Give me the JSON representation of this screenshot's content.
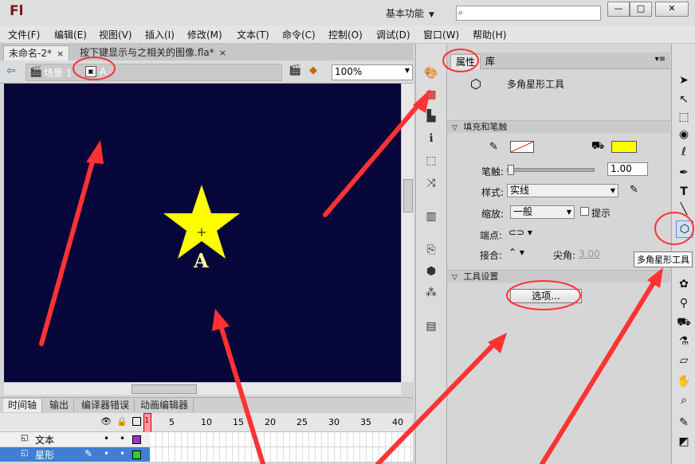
{
  "app": {
    "logo": "Fl",
    "workspace": "基本功能"
  },
  "window_buttons": {
    "minimize": "—",
    "maximize": "□",
    "close": "✕"
  },
  "menu": [
    "文件(F)",
    "编辑(E)",
    "视图(V)",
    "插入(I)",
    "修改(M)",
    "文本(T)",
    "命令(C)",
    "控制(O)",
    "调试(D)",
    "窗口(W)",
    "帮助(H)"
  ],
  "doc_tabs": [
    {
      "label": "未命名-2*",
      "close": "×"
    },
    {
      "label": "按下键显示与之相关的图像.fla*",
      "close": "×"
    }
  ],
  "editbar": {
    "scene": "场景 1",
    "symbol": "A",
    "zoom": "100%"
  },
  "stage": {
    "symbol_label": "A",
    "background": "#07063a",
    "star_color": "#ffff00"
  },
  "timeline": {
    "tabs": [
      "时间轴",
      "输出",
      "编译器错误",
      "动画编辑器"
    ],
    "frame_numbers": [
      "5",
      "10",
      "15",
      "20",
      "25",
      "30",
      "35",
      "40"
    ],
    "current_frame": "1",
    "layers": [
      {
        "name": "文本",
        "color": "#9933cc"
      },
      {
        "name": "星形",
        "color": "#33cc33"
      }
    ]
  },
  "properties": {
    "tabs": [
      "属性",
      "库"
    ],
    "tool_name": "多角星形工具",
    "sections": {
      "fill_stroke": "填充和笔触",
      "tool_settings": "工具设置"
    },
    "stroke_label": "笔触:",
    "stroke_value": "1.00",
    "style_label": "样式:",
    "style_value": "实线",
    "scale_label": "缩放:",
    "scale_value": "一般",
    "hint_label": "提示",
    "cap_label": "端点:",
    "join_label": "接合:",
    "miter_label": "尖角:",
    "miter_value": "3.00",
    "options_button": "选项...",
    "stroke_color": "#ff0000",
    "fill_color": "#ffff00"
  },
  "tooltip": "多角星形工具",
  "annotation_color": "#ff3333"
}
